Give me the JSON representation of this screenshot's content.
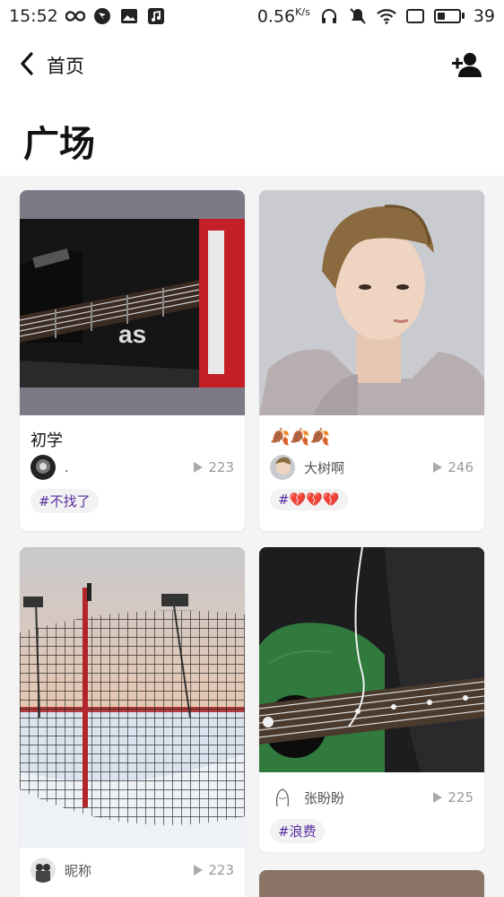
{
  "status_bar": {
    "time": "15:52",
    "net_speed_value": "0.56",
    "net_speed_unit": "K/s",
    "battery_level": "39",
    "icons": [
      "infinity-icon",
      "app-icon",
      "image-icon",
      "music-icon",
      "headphones-icon",
      "mute-icon",
      "wifi-icon",
      "screen-icon",
      "battery-icon"
    ]
  },
  "header": {
    "back_label": "首页",
    "title": "广场",
    "add_user_icon": "add-user-icon"
  },
  "colors": {
    "tag_text": "#5a2ca0",
    "tag_bg": "#f2f2f2",
    "muted": "#999999",
    "background": "#f4f4f4"
  },
  "feed": {
    "cards": [
      {
        "title": "初学",
        "author": ".",
        "plays": "223",
        "tag": "#不找了",
        "image": "guitar-photo"
      },
      {
        "title": "🍂🍂🍂",
        "author": "大树啊",
        "plays": "246",
        "tag": "#💔💔💔",
        "image": "portrait-photo"
      },
      {
        "title": "",
        "author": "昵称",
        "plays": "223",
        "tag": "",
        "image": "net-sunset-photo"
      },
      {
        "title": "",
        "author": "张盼盼",
        "plays": "225",
        "tag": "#浪费",
        "image": "green-guitar-photo"
      }
    ]
  }
}
